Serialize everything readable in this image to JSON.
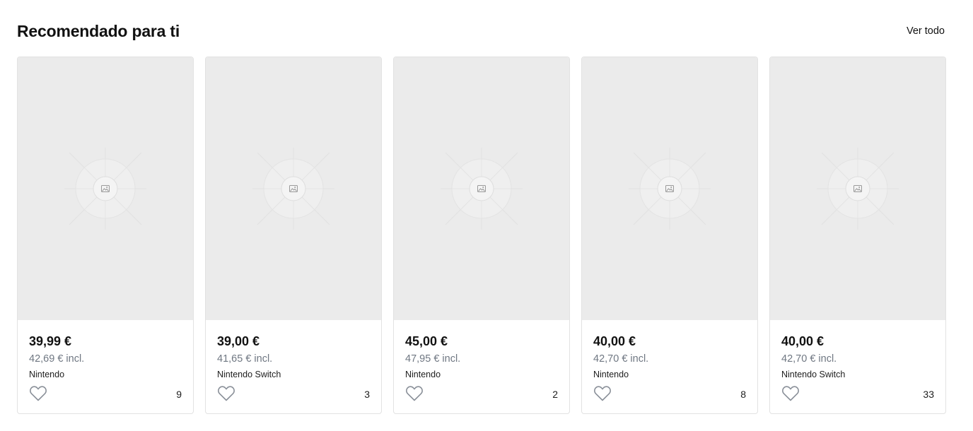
{
  "section": {
    "title": "Recomendado para ti",
    "see_all_label": "Ver todo"
  },
  "products": [
    {
      "price": "39,99 €",
      "price_incl": "42,69 € incl.",
      "brand": "Nintendo",
      "favourites": "9",
      "image_icon": "image-placeholder-icon",
      "favourite_icon": "heart-icon"
    },
    {
      "price": "39,00 €",
      "price_incl": "41,65 € incl.",
      "brand": "Nintendo Switch",
      "favourites": "3",
      "image_icon": "image-placeholder-icon",
      "favourite_icon": "heart-icon"
    },
    {
      "price": "45,00 €",
      "price_incl": "47,95 € incl.",
      "brand": "Nintendo",
      "favourites": "2",
      "image_icon": "image-placeholder-icon",
      "favourite_icon": "heart-icon"
    },
    {
      "price": "40,00 €",
      "price_incl": "42,70 € incl.",
      "brand": "Nintendo",
      "favourites": "8",
      "image_icon": "image-placeholder-icon",
      "favourite_icon": "heart-icon"
    },
    {
      "price": "40,00 €",
      "price_incl": "42,70 € incl.",
      "brand": "Nintendo Switch",
      "favourites": "33",
      "image_icon": "image-placeholder-icon",
      "favourite_icon": "heart-icon"
    }
  ],
  "colors": {
    "placeholder_bg": "#ebebeb",
    "secondary_text": "#6f7782",
    "heart_stroke": "#8a9099",
    "card_border": "#e2e2e2"
  }
}
